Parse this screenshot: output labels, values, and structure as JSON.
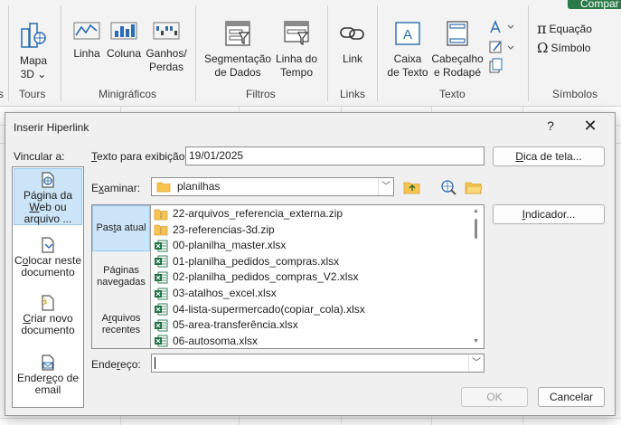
{
  "ribbon": {
    "share_label": "Compar",
    "tours": {
      "item": "Mapa\n3D ⌄",
      "group": "Tours"
    },
    "sparklines": {
      "items": [
        "Linha",
        "Coluna",
        "Ganhos/\nPerdas"
      ],
      "group": "Minigráficos"
    },
    "filters": {
      "items": [
        "Segmentação\nde Dados",
        "Linha do\nTempo"
      ],
      "group": "Filtros"
    },
    "links": {
      "item": "Link",
      "group": "Links"
    },
    "text": {
      "items": [
        "Caixa\nde Texto",
        "Cabeçalho\ne Rodapé"
      ],
      "group": "Texto"
    },
    "symbols": {
      "equation": "Equação",
      "symbol": "Símbolo",
      "group": "Símbolos"
    },
    "left_edge_mark": "s"
  },
  "dialog": {
    "title": "Inserir Hiperlink",
    "help": "?",
    "close": "✕",
    "link_to_label": "Vincular a:",
    "link_to": [
      {
        "label": "Página da Web ou arquivo ...",
        "underline": "W",
        "selected": true
      },
      {
        "label": "Colocar neste documento",
        "underline": "o",
        "selected": false
      },
      {
        "label": "Criar novo documento",
        "underline": "C",
        "selected": false
      },
      {
        "label": "Endereço de email",
        "underline": "n",
        "selected": false
      }
    ],
    "display_text_label": "Texto para exibição:",
    "display_text_value": "19/01/2025",
    "screentip_button": "Dica de tela...",
    "look_in_label": "Examinar:",
    "look_in_value": "planilhas",
    "browse_sections": [
      {
        "label": "Pasta atual",
        "selected": true
      },
      {
        "label": "Páginas navegadas",
        "selected": false
      },
      {
        "label": "Arquivos recentes",
        "selected": false
      }
    ],
    "files": [
      {
        "name": "22-arquivos_referencia_externa.zip",
        "type": "zip"
      },
      {
        "name": "23-referencias-3d.zip",
        "type": "zip"
      },
      {
        "name": "00-planilha_master.xlsx",
        "type": "xlsx"
      },
      {
        "name": "01-planilha_pedidos_compras.xlsx",
        "type": "xlsx"
      },
      {
        "name": "02-planilha_pedidos_compras_V2.xlsx",
        "type": "xlsx"
      },
      {
        "name": "03-atalhos_excel.xlsx",
        "type": "xlsx"
      },
      {
        "name": "04-lista-supermercado(copiar_cola).xlsx",
        "type": "xlsx"
      },
      {
        "name": "05-area-transferência.xlsx",
        "type": "xlsx"
      },
      {
        "name": "06-autosoma.xlsx",
        "type": "xlsx"
      }
    ],
    "bookmark_button": "Indicador...",
    "address_label": "Endereço:",
    "address_value": "",
    "ok_button": "OK",
    "cancel_button": "Cancelar"
  },
  "colors": {
    "selection": "#cce4f7",
    "folder": "#f8c44f",
    "excel": "#1d6f42",
    "icon_blue": "#2b6cb0"
  }
}
